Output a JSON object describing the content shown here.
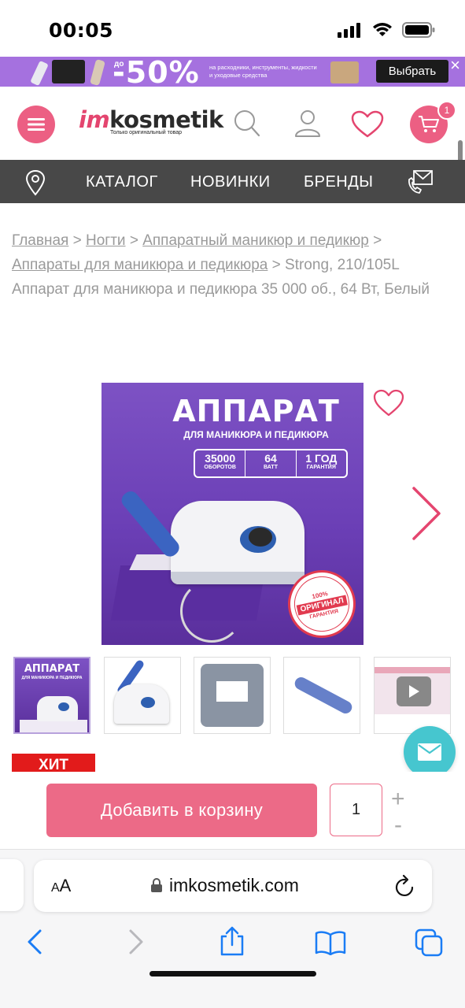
{
  "status_bar": {
    "time": "00:05"
  },
  "promo": {
    "prefix": "до",
    "discount": "-50%",
    "text": "на расходники, инструменты, жидкости и уходовые средства",
    "button": "Выбрать",
    "close": "×"
  },
  "header": {
    "logo_im": "im",
    "logo_rest": "kosmetik",
    "logo_tagline": "Только оригинальный товар",
    "cart_count": "1"
  },
  "nav": {
    "items": [
      "КАТАЛОГ",
      "НОВИНКИ",
      "БРЕНДЫ"
    ]
  },
  "breadcrumb": {
    "links": [
      "Главная",
      "Ногти",
      "Аппаратный маникюр и педикюр",
      "Аппараты для маникюра и педикюра"
    ],
    "separator": ">",
    "current": "Strong, 210/105L Аппарат для маникюра и педикюра 35 000 об., 64 Вт, Белый"
  },
  "product_image": {
    "title": "АППАРАТ",
    "subtitle": "ДЛЯ МАНИКЮРА И ПЕДИКЮРА",
    "specs": [
      {
        "value": "35000",
        "unit": "ОБОРОТОВ"
      },
      {
        "value": "64",
        "unit": "ВАТТ"
      },
      {
        "value": "1 ГОД",
        "unit": "ГАРАНТИЯ"
      }
    ],
    "stamp_top": "100%",
    "stamp_band": "ОРИГИНАЛ",
    "stamp_bottom": "ГАРАНТИЯ"
  },
  "thumbnails": {
    "t1_title": "АППАРАТ",
    "t1_sub": "ДЛЯ МАНИКЮРА И ПЕДИКЮРА"
  },
  "badge": "ХИТ",
  "cart_bar": {
    "add_label": "Добавить в корзину",
    "quantity": "1",
    "plus": "+",
    "minus": "-"
  },
  "browser": {
    "aa_small": "A",
    "aa_big": "A",
    "url": "imkosmetik.com"
  },
  "colors": {
    "accent_pink": "#ec5f83",
    "nav_bg": "#484848",
    "promo_purple": "#a571df",
    "fab_teal": "#46c6cf",
    "hit_red": "#e21b1b"
  }
}
